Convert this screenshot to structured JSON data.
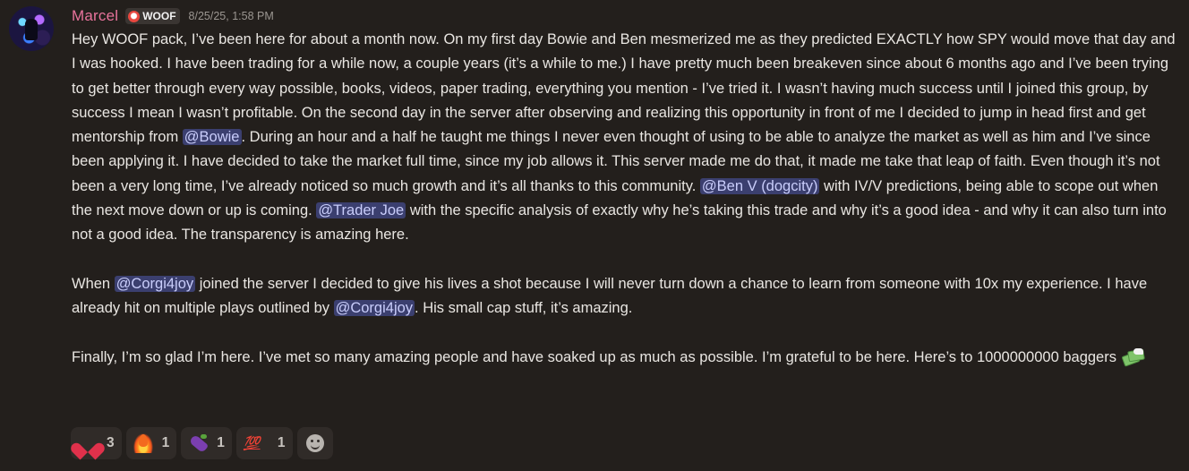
{
  "message": {
    "author": "Marcel",
    "author_color": "#e8739c",
    "tag_label": "WOOF",
    "timestamp": "8/25/25, 1:58 PM",
    "paragraph1": {
      "t1": "Hey WOOF pack, I’ve been here for about a month now. On my first day Bowie and Ben mesmerized me as they predicted EXACTLY how SPY would move that day and I was hooked. I have been trading for a while now, a couple years (it’s a while to me.) I have pretty much been breakeven since about 6 months ago and I’ve been trying to get better through every way possible, books, videos, paper trading, everything you mention - I’ve tried it. I wasn’t having much success until I joined this group, by success I mean I wasn’t profitable. On the second day in the server after observing and realizing this opportunity in front of me I decided to jump in head first and get mentorship from ",
      "m1": "@Bowie",
      "t2": ". During an hour and a half he taught me things I never even thought of using to be able to analyze the market as well as him and I’ve since been applying it. I have decided to take the market full time, since my job allows it. This server made me do that, it made me take that leap of faith. Even though it’s not been a very long time, I’ve already noticed so much growth and it’s all thanks to this community. ",
      "m2": "@Ben V (dogcity)",
      "t3": " with IV/V predictions, being able to scope out when the next move down or up is coming. ",
      "m3": "@Trader Joe",
      "t4": " with the specific analysis of exactly why he’s taking this trade and why it’s a good idea - and why it can also turn into not a good idea. The transparency is amazing here."
    },
    "paragraph2": {
      "t1": "When ",
      "m1": "@Corgi4joy",
      "t2": " joined the server I decided to give his lives a shot because I will never turn down a chance to learn from someone with 10x my experience. I have already hit on multiple plays outlined by ",
      "m2": "@Corgi4joy",
      "t3": ". His small cap stuff, it’s amazing."
    },
    "paragraph3": {
      "t1": "Finally, I’m so glad I’m here. I’ve met so many amazing people and have soaked up as much as possible. I’m grateful to be here. Here’s to 1000000000 baggers",
      "emoji_icon": "money-with-wings-icon"
    }
  },
  "reactions": [
    {
      "icon": "heart-icon",
      "count": "3"
    },
    {
      "icon": "fire-icon",
      "count": "1"
    },
    {
      "icon": "eggplant-icon",
      "count": "1"
    },
    {
      "icon": "hundred-points-icon",
      "count": "1"
    }
  ],
  "hundred_glyph": "💯",
  "add_reaction_icon": "smile-icon",
  "colors": {
    "background": "#231f1c",
    "mention_bg": "#3b3f6f",
    "mention_text": "#c9cdfb",
    "text": "#e9e6e2",
    "timestamp": "#9b9691"
  }
}
